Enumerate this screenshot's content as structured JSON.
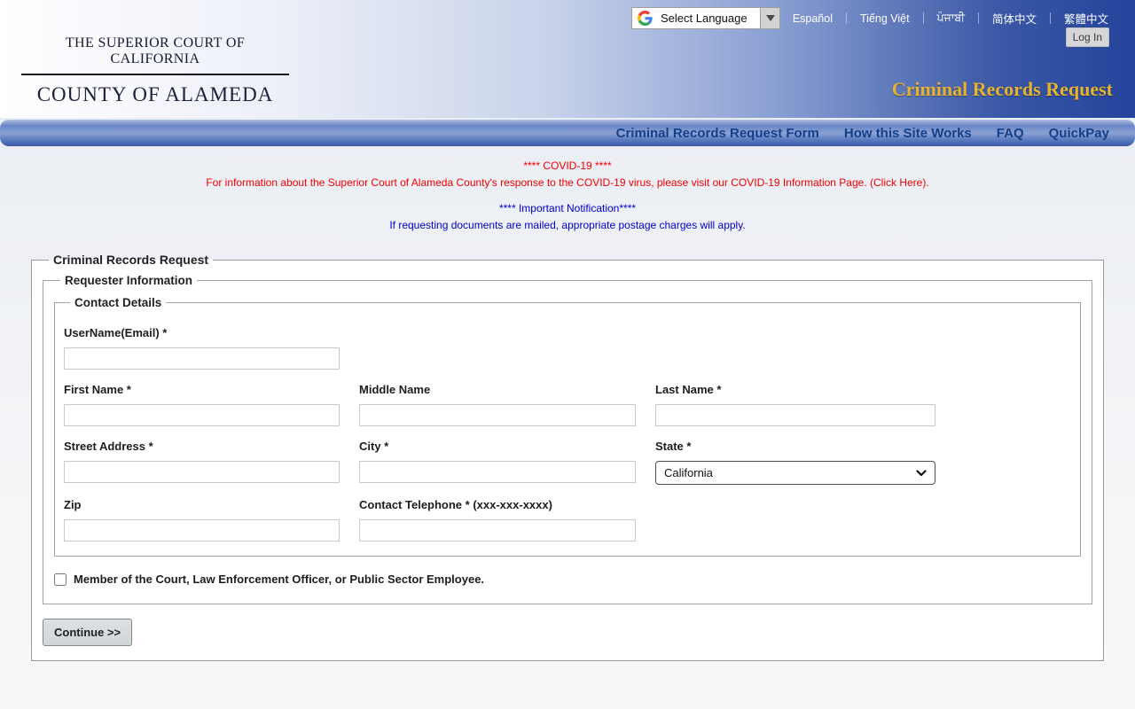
{
  "translate_widget": {
    "label": "Select Language"
  },
  "top_bar": {
    "languages": [
      "Español",
      "Tiếng Việt",
      "ਪੰਜਾਬੀ",
      "简体中文",
      "繁體中文"
    ],
    "login_label": "Log In"
  },
  "header": {
    "court_line1": "THE SUPERIOR COURT OF CALIFORNIA",
    "court_line2": "COUNTY OF ALAMEDA",
    "page_title": "Criminal Records Request"
  },
  "nav": {
    "items": [
      "Criminal Records Request Form",
      "How this Site Works",
      "FAQ",
      "QuickPay"
    ]
  },
  "notices": {
    "covid_title": "**** COVID-19 ****",
    "covid_body_prefix": "For information about the Superior Court of Alameda County's response to the COVID-19 virus, please visit our ",
    "covid_link": "COVID-19 Information Page. (Click Here).",
    "important_title": "**** Important Notification****",
    "important_body": "If requesting documents are mailed, appropriate postage charges will apply."
  },
  "form": {
    "legend_outer": "Criminal Records Request",
    "legend_requester": "Requester Information",
    "legend_contact": "Contact Details",
    "labels": {
      "username": "UserName(Email) *",
      "first_name": "First Name *",
      "middle_name": "Middle Name",
      "last_name": "Last Name *",
      "street": "Street Address *",
      "city": "City *",
      "state": "State *",
      "zip": "Zip",
      "phone": "Contact Telephone * (xxx-xxx-xxxx)"
    },
    "values": {
      "state": "California"
    },
    "member_label": "Member of the Court, Law Enforcement Officer, or Public Sector Employee.",
    "continue_label": "Continue >>"
  },
  "colors": {
    "header_deep_blue": "#24439b",
    "nav_text_blue": "#14408a",
    "title_gold": "#e7b22d",
    "notice_red": "#f00000",
    "notice_blue": "#0000cc"
  }
}
